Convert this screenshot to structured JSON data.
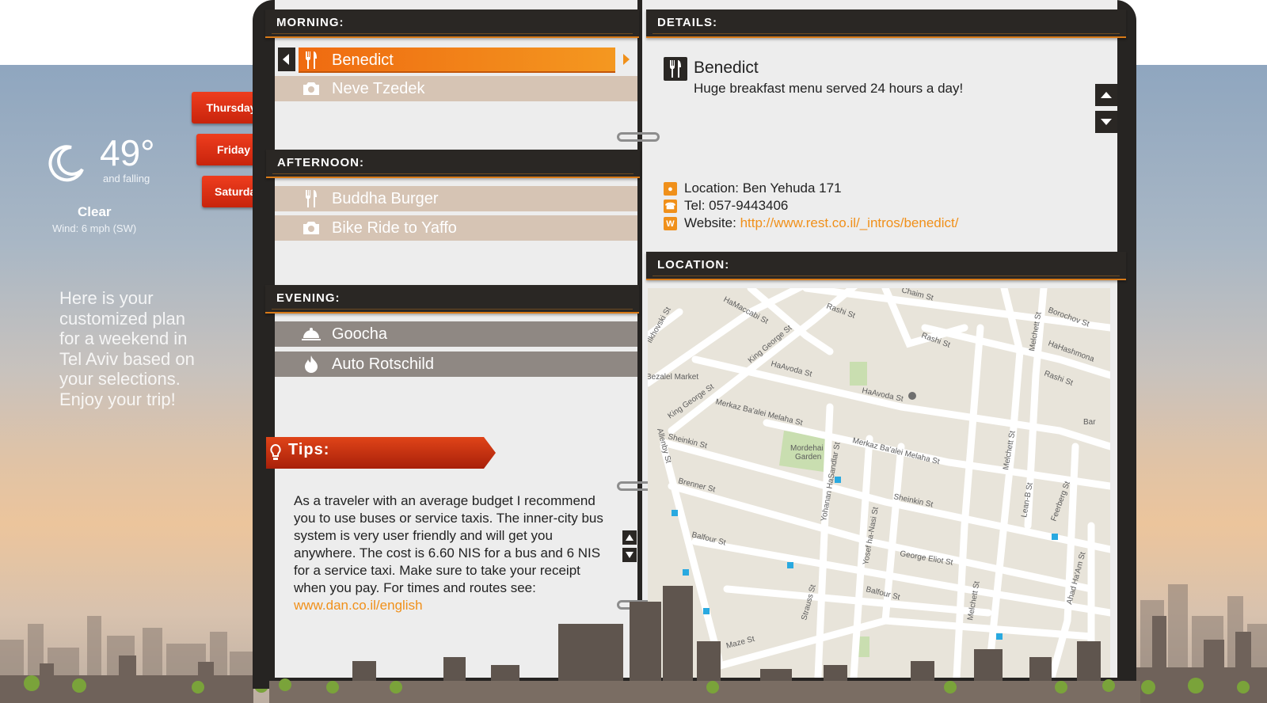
{
  "weather": {
    "temperature": "49°",
    "trend": "and falling",
    "condition": "Clear",
    "wind": "Wind: 6 mph (SW)"
  },
  "intro_text": "Here is your customized plan for a weekend in Tel Aviv based on your selections. Enjoy your trip!",
  "days": [
    "Thursday",
    "Friday",
    "Saturday"
  ],
  "sections": {
    "morning": "MORNING:",
    "afternoon": "AFTERNOON:",
    "evening": "EVENING:",
    "details": "DETAILS:",
    "location": "LOCATION:"
  },
  "morning": [
    {
      "label": "Benedict",
      "icon": "fork-knife-icon"
    },
    {
      "label": "Neve Tzedek",
      "icon": "camera-icon"
    }
  ],
  "afternoon": [
    {
      "label": "Buddha Burger",
      "icon": "fork-knife-icon"
    },
    {
      "label": "Bike Ride to Yaffo",
      "icon": "camera-icon"
    }
  ],
  "evening": [
    {
      "label": "Goocha",
      "icon": "cloche-icon"
    },
    {
      "label": "Auto Rotschild",
      "icon": "flame-icon"
    }
  ],
  "details": {
    "title": "Benedict",
    "description": "Huge breakfast menu served 24 hours a day!",
    "location": "Location: Ben Yehuda 171",
    "tel": "Tel: 057-9443406",
    "website_label": "Website: ",
    "website_url": "http://www.rest.co.il/_intros/benedict/"
  },
  "tips": {
    "title": "Tips:",
    "body": "As a traveler with an average budget I recommend you to use buses or service taxis. The inner-city bus system is very user friendly and will get you anywhere. The cost is 6.60 NIS for a bus and 6 NIS for a service taxi. Make sure to take your receipt when you pay. For times and routes see: ",
    "link": "www.dan.co.il/english"
  },
  "map_labels": {
    "haMaccabi": "HaMaccabi St",
    "rashi1": "Rashi St",
    "rashi2": "Rashi St",
    "rashi3": "Rashi St",
    "borochov": "Borochov St",
    "haHashmona": "HaHashmona",
    "kingGeorge1": "King George St",
    "kingGeorge2": "King George St",
    "haAvoda1": "HaAvoda St",
    "haAvoda2": "HaAvoda St",
    "bezalel": "Bezalel Market",
    "merkaz1": "Merkaz Ba'alei Melaha St",
    "merkaz2": "Merkaz Ba'alei Melaha St",
    "sheinkin1": "Sheinkin St",
    "sheinkin2": "Sheinkin St",
    "mordehai": "Mordehai",
    "garden": "Garden",
    "brenner": "Brenner St",
    "allenby": "Allenby St",
    "balfour1": "Balfour St",
    "balfour2": "Balfour St",
    "georgeEliot": "George Eliot St",
    "melchett1": "Melchett St",
    "melchett2": "Melchett St",
    "melchett3": "Melchett St",
    "yohanan": "Yohanan HaSandlar St",
    "yosef": "Yosef ha-Nasi St",
    "lean": "Lean-B St",
    "feerberg": "Feerberg St",
    "ahad": "Ahad Ha'Am St",
    "strauss": "Strauss St",
    "maze": "Maze St",
    "bar": "Bar",
    "chaim": "Chaim St",
    "mikhovski": "Ilkhovski St"
  }
}
